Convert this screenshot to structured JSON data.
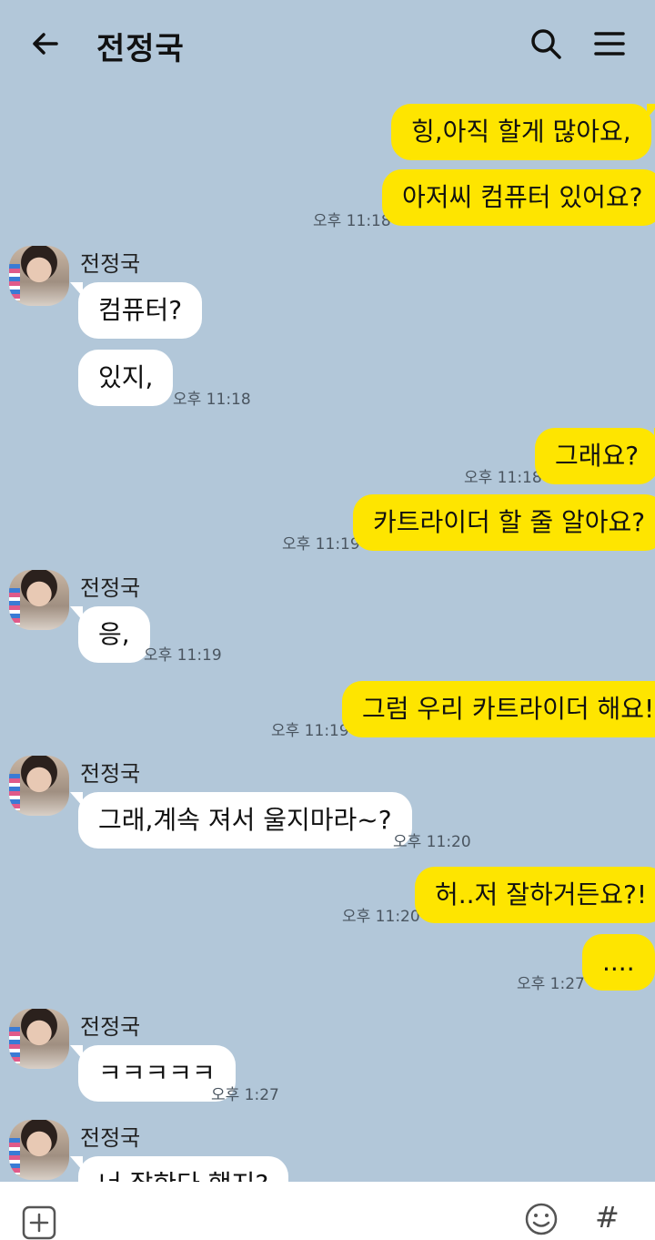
{
  "header": {
    "title": "전정국",
    "back_icon": "arrow-left-icon",
    "search_icon": "search-icon",
    "menu_icon": "menu-icon"
  },
  "messages": {
    "m1": "힝,아직 할게 많아요,",
    "m2": "아저씨 컴퓨터 있어요?",
    "t2": "오후 11:18",
    "sender": "전정국",
    "m3": "컴퓨터?",
    "m4": "있지,",
    "t4": "오후 11:18",
    "m5": "그래요?",
    "t5": "오후 11:18",
    "m6": "카트라이더 할 줄 알아요?",
    "t6": "오후 11:19",
    "m7": "응,",
    "t7": "오후 11:19",
    "m8": "그럼 우리 카트라이더 해요!",
    "t8": "오후 11:19",
    "m9": "그래,계속 져서 울지마라~?",
    "t9": "오후 11:20",
    "m10": "허..저 잘하거든요?!",
    "t10": "오후 11:20",
    "m11": "....",
    "t11": "오후 1:27",
    "m12": "ㅋㅋㅋㅋㅋ",
    "t12": "오후 1:27",
    "m13": "너 잘한다 했지?"
  },
  "composer": {
    "plus_icon": "plus-square-icon",
    "emoji_icon": "emoji-icon",
    "hash_label": "#"
  },
  "colors": {
    "background": "#b2c7d9",
    "my_bubble": "#fee500",
    "other_bubble": "#ffffff"
  }
}
